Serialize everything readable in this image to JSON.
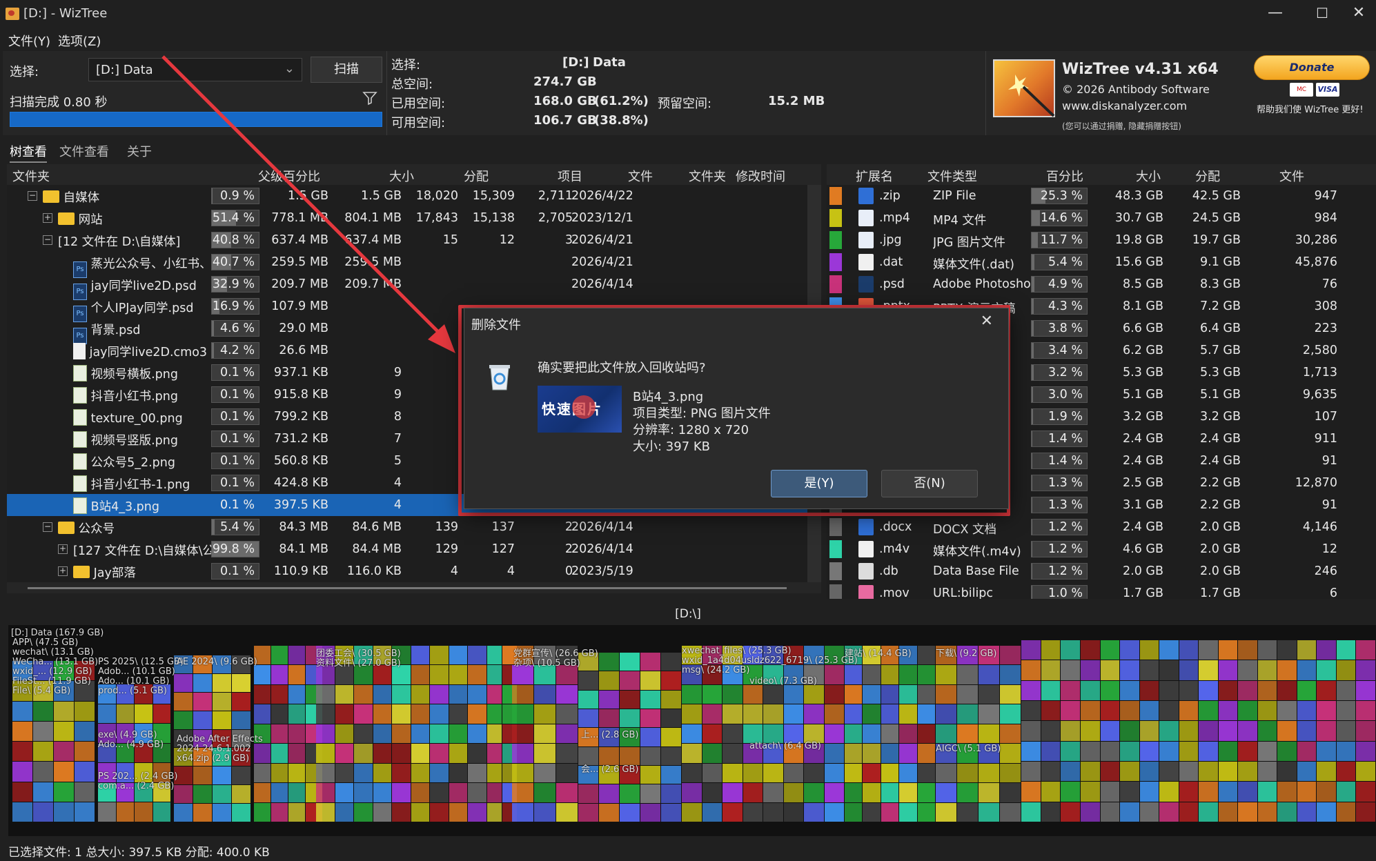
{
  "window": {
    "title": "[D:]  - WizTree",
    "minimize": "—",
    "maximize": "☐",
    "close": "✕"
  },
  "menu": [
    "文件(Y)",
    "选项(Z)"
  ],
  "left_panel": {
    "select_label": "选择:",
    "drive_value": "[D:] Data",
    "scan_button": "扫描",
    "scan_status": "扫描完成 0.80 秒"
  },
  "info": {
    "select_label": "选择:",
    "drive": "[D:]",
    "drive_name": "Data",
    "total_label": "总空间:",
    "total_value": "274.7 GB",
    "used_label": "已用空间:",
    "used_value": "168.0 GB",
    "used_pct": "(61.2%)",
    "reserved_label": "预留空间:",
    "reserved_value": "15.2 MB",
    "free_label": "可用空间:",
    "free_value": "106.7 GB",
    "free_pct": "(38.8%)"
  },
  "brand": {
    "name": "WizTree v4.31 x64",
    "copyright": "© 2026 Antibody Software",
    "url": "www.diskanalyzer.com",
    "note": "(您可以通过捐赠, 隐藏捐赠按钮)",
    "donate": "Donate",
    "donate_help": "帮助我们使 WizTree 更好!",
    "mc": "MC",
    "visa": "VISA"
  },
  "tabs": [
    "树查看",
    "文件查看",
    "关于"
  ],
  "tree": {
    "headers": [
      "文件夹",
      "父级百分比",
      "大小",
      "分配",
      "项目",
      "文件",
      "文件夹",
      "修改时间"
    ],
    "rows": [
      {
        "name": "自媒体",
        "pct": "0.9 %",
        "pct_fill": 0.009,
        "size": "1.5 GB",
        "alloc": "1.5 GB",
        "items": "18,020",
        "files": "15,309",
        "folders": "2,711",
        "mtime": "2026/4/22",
        "type": "folder",
        "depth": 1,
        "exp": "−"
      },
      {
        "name": "网站",
        "pct": "51.4 %",
        "pct_fill": 0.514,
        "size": "778.1 MB",
        "alloc": "804.1 MB",
        "items": "17,843",
        "files": "15,138",
        "folders": "2,705",
        "mtime": "2023/12/1",
        "type": "folder",
        "depth": 2,
        "exp": "+"
      },
      {
        "name": "[12 文件在 D:\\自媒体]",
        "pct": "40.8 %",
        "pct_fill": 0.408,
        "size": "637.4 MB",
        "alloc": "637.4 MB",
        "items": "15",
        "files": "12",
        "folders": "3",
        "mtime": "2026/4/21",
        "type": "none",
        "depth": 2,
        "exp": "−"
      },
      {
        "name": "蒸光公众号、小红书、",
        "pct": "40.7 %",
        "pct_fill": 0.407,
        "size": "259.5 MB",
        "alloc": "259.5 MB",
        "items": "",
        "files": "",
        "folders": "",
        "mtime": "2026/4/21",
        "type": "ps",
        "depth": 3
      },
      {
        "name": "jay同学live2D.psd",
        "pct": "32.9 %",
        "pct_fill": 0.329,
        "size": "209.7 MB",
        "alloc": "209.7 MB",
        "items": "",
        "files": "",
        "folders": "",
        "mtime": "2026/4/14",
        "type": "ps",
        "depth": 3
      },
      {
        "name": "个人IPJay同学.psd",
        "pct": "16.9 %",
        "pct_fill": 0.169,
        "size": "107.9 MB",
        "alloc": "",
        "items": "",
        "files": "",
        "folders": "",
        "mtime": "",
        "type": "ps",
        "depth": 3
      },
      {
        "name": "背景.psd",
        "pct": "4.6 %",
        "pct_fill": 0.046,
        "size": "29.0 MB",
        "alloc": "",
        "items": "",
        "files": "",
        "folders": "",
        "mtime": "",
        "type": "ps",
        "depth": 3
      },
      {
        "name": "jay同学live2D.cmo3",
        "pct": "4.2 %",
        "pct_fill": 0.042,
        "size": "26.6 MB",
        "alloc": "",
        "items": "",
        "files": "",
        "folders": "",
        "mtime": "",
        "type": "file",
        "depth": 3
      },
      {
        "name": "视频号横板.png",
        "pct": "0.1 %",
        "pct_fill": 0.001,
        "size": "937.1 KB",
        "alloc": "9",
        "items": "",
        "files": "",
        "folders": "",
        "mtime": "",
        "type": "png",
        "depth": 3
      },
      {
        "name": "抖音小红书.png",
        "pct": "0.1 %",
        "pct_fill": 0.001,
        "size": "915.8 KB",
        "alloc": "9",
        "items": "",
        "files": "",
        "folders": "",
        "mtime": "",
        "type": "png",
        "depth": 3
      },
      {
        "name": "texture_00.png",
        "pct": "0.1 %",
        "pct_fill": 0.001,
        "size": "799.2 KB",
        "alloc": "8",
        "items": "",
        "files": "",
        "folders": "",
        "mtime": "",
        "type": "png",
        "depth": 3
      },
      {
        "name": "视频号竖版.png",
        "pct": "0.1 %",
        "pct_fill": 0.001,
        "size": "731.2 KB",
        "alloc": "7",
        "items": "",
        "files": "",
        "folders": "",
        "mtime": "",
        "type": "png",
        "depth": 3
      },
      {
        "name": "公众号5_2.png",
        "pct": "0.1 %",
        "pct_fill": 0.001,
        "size": "560.8 KB",
        "alloc": "5",
        "items": "",
        "files": "",
        "folders": "",
        "mtime": "",
        "type": "png",
        "depth": 3
      },
      {
        "name": "抖音小红书-1.png",
        "pct": "0.1 %",
        "pct_fill": 0.001,
        "size": "424.8 KB",
        "alloc": "4",
        "items": "",
        "files": "",
        "folders": "",
        "mtime": "",
        "type": "png",
        "depth": 3
      },
      {
        "name": "B站4_3.png",
        "pct": "0.1 %",
        "pct_fill": 0.001,
        "size": "397.5 KB",
        "alloc": "4",
        "items": "",
        "files": "",
        "folders": "",
        "mtime": "",
        "type": "png",
        "depth": 3,
        "selected": true
      },
      {
        "name": "公众号",
        "pct": "5.4 %",
        "pct_fill": 0.054,
        "size": "84.3 MB",
        "alloc": "84.6 MB",
        "items": "139",
        "files": "137",
        "folders": "2",
        "mtime": "2026/4/14",
        "type": "folder",
        "depth": 2,
        "exp": "−"
      },
      {
        "name": "[127 文件在 D:\\自媒体\\公",
        "pct": "99.8 %",
        "pct_fill": 0.998,
        "size": "84.1 MB",
        "alloc": "84.4 MB",
        "items": "129",
        "files": "127",
        "folders": "2",
        "mtime": "2026/4/14",
        "type": "none",
        "depth": 3,
        "exp": "+"
      },
      {
        "name": "Jay部落",
        "pct": "0.1 %",
        "pct_fill": 0.001,
        "size": "110.9 KB",
        "alloc": "116.0 KB",
        "items": "4",
        "files": "4",
        "folders": "0",
        "mtime": "2023/5/19",
        "type": "folder",
        "depth": 3,
        "exp": "+"
      }
    ]
  },
  "ext": {
    "headers": [
      "扩展名",
      "文件类型",
      "百分比",
      "大小",
      "分配",
      "文件"
    ],
    "rows": [
      {
        "ext": ".zip",
        "type": "ZIP File",
        "pct": "25.3 %",
        "pct_fill": 0.253,
        "size": "48.3 GB",
        "alloc": "42.5 GB",
        "files": "947",
        "color": "#e07b22",
        "icon": "#2f6fd6"
      },
      {
        "ext": ".mp4",
        "type": "MP4 文件",
        "pct": "14.6 %",
        "pct_fill": 0.146,
        "size": "30.7 GB",
        "alloc": "24.5 GB",
        "files": "984",
        "color": "#c7c214",
        "icon": "#e8eef8"
      },
      {
        "ext": ".jpg",
        "type": "JPG 图片文件",
        "pct": "11.7 %",
        "pct_fill": 0.117,
        "size": "19.8 GB",
        "alloc": "19.7 GB",
        "files": "30,286",
        "color": "#27a83a",
        "icon": "#e8eef8"
      },
      {
        "ext": ".dat",
        "type": "媒体文件(.dat)",
        "pct": "5.4 %",
        "pct_fill": 0.054,
        "size": "15.6 GB",
        "alloc": "9.1 GB",
        "files": "45,876",
        "color": "#9b37d8",
        "icon": "#f0f0f0"
      },
      {
        "ext": ".psd",
        "type": "Adobe Photosho",
        "pct": "4.9 %",
        "pct_fill": 0.049,
        "size": "8.5 GB",
        "alloc": "8.3 GB",
        "files": "76",
        "color": "#c8327a",
        "icon": "#1b3c6b"
      },
      {
        "ext": ".pptx",
        "type": "PPTX 演示文稿",
        "pct": "4.3 %",
        "pct_fill": 0.043,
        "size": "8.1 GB",
        "alloc": "7.2 GB",
        "files": "308",
        "color": "#3d8ee8",
        "icon": "#e0553a"
      },
      {
        "ext": "",
        "type": "",
        "pct": "3.8 %",
        "pct_fill": 0.038,
        "size": "6.6 GB",
        "alloc": "6.4 GB",
        "files": "223",
        "color": "#555",
        "icon": ""
      },
      {
        "ext": "",
        "type": "",
        "pct": "3.4 %",
        "pct_fill": 0.034,
        "size": "6.2 GB",
        "alloc": "5.7 GB",
        "files": "2,580",
        "color": "#555",
        "icon": ""
      },
      {
        "ext": "",
        "type": "",
        "pct": "3.2 %",
        "pct_fill": 0.032,
        "size": "5.3 GB",
        "alloc": "5.3 GB",
        "files": "1,713",
        "color": "#555",
        "icon": ""
      },
      {
        "ext": "",
        "type": "",
        "pct": "3.0 %",
        "pct_fill": 0.03,
        "size": "5.1 GB",
        "alloc": "5.1 GB",
        "files": "9,635",
        "color": "#555",
        "icon": ""
      },
      {
        "ext": "",
        "type": "",
        "pct": "1.9 %",
        "pct_fill": 0.019,
        "size": "3.2 GB",
        "alloc": "3.2 GB",
        "files": "107",
        "color": "#555",
        "icon": ""
      },
      {
        "ext": "",
        "type": "",
        "pct": "1.4 %",
        "pct_fill": 0.014,
        "size": "2.4 GB",
        "alloc": "2.4 GB",
        "files": "911",
        "color": "#555",
        "icon": ""
      },
      {
        "ext": "",
        "type": "",
        "pct": "1.4 %",
        "pct_fill": 0.014,
        "size": "2.4 GB",
        "alloc": "2.4 GB",
        "files": "91",
        "color": "#555",
        "icon": ""
      },
      {
        "ext": "",
        "type": "",
        "pct": "1.3 %",
        "pct_fill": 0.013,
        "size": "2.5 GB",
        "alloc": "2.2 GB",
        "files": "12,870",
        "color": "#555",
        "icon": ""
      },
      {
        "ext": "",
        "type": "",
        "pct": "1.3 %",
        "pct_fill": 0.013,
        "size": "3.1 GB",
        "alloc": "2.2 GB",
        "files": "91",
        "color": "#555",
        "icon": ""
      },
      {
        "ext": ".docx",
        "type": "DOCX 文档",
        "pct": "1.2 %",
        "pct_fill": 0.012,
        "size": "2.4 GB",
        "alloc": "2.0 GB",
        "files": "4,146",
        "color": "#666",
        "icon": "#2f6fd6"
      },
      {
        "ext": ".m4v",
        "type": "媒体文件(.m4v)",
        "pct": "1.2 %",
        "pct_fill": 0.012,
        "size": "4.6 GB",
        "alloc": "2.0 GB",
        "files": "12",
        "color": "#2ed3a8",
        "icon": "#f0f0f0"
      },
      {
        "ext": ".db",
        "type": "Data Base File",
        "pct": "1.2 %",
        "pct_fill": 0.012,
        "size": "2.0 GB",
        "alloc": "2.0 GB",
        "files": "246",
        "color": "#777",
        "icon": "#dcdcdc"
      },
      {
        "ext": ".mov",
        "type": "URL:bilipc",
        "pct": "1.0 %",
        "pct_fill": 0.01,
        "size": "1.7 GB",
        "alloc": "1.7 GB",
        "files": "6",
        "color": "#666",
        "icon": "#e86aa0"
      }
    ]
  },
  "treemap": {
    "root_label": "[D:\\]",
    "title": "[D:] Data  (167.9 GB)",
    "labels": [
      "APP\\ (47.5 GB)",
      "wechat\\ (13.1 GB)",
      "WeCha... (13.1 GB)",
      "wxid_... (12.9 GB)",
      "FileSt... (11.9 GB)",
      "File\\ (5.4 GB)",
      "PS 2025\\ (12.5 GB)",
      "Adob... (10.1 GB)",
      "Ado... (10.1 GB)",
      "prod... (5.1 GB)",
      "exe\\ (4.9 GB)",
      "Ado... (4.9 GB)",
      "PS 202... (2.4 GB)",
      "com.a... (2.4 GB)",
      "AE 2024\\ (9.6 GB)",
      "Adobe After Effects",
      "2024 24.6.1.002",
      "x64.zip (2.9 GB)",
      "团委工会\\ (30.5 GB)",
      "资料文件\\ (27.0 GB)",
      "党群宣传\\ (26.6 GB)",
      "杂项\\ (10.5 GB)",
      "上... (2.8 GB)",
      "会... (2.6 GB)",
      "xwechat_files\\ (25.3 GB)",
      "wxid_1a4d04usldz622_6719\\ (25.3 GB)",
      "msg\\ (24.2 GB)",
      "video\\ (7.3 GB)",
      "attach\\ (6.4 GB)",
      "建站\\ (14.4 GB)",
      "下载\\ (9.2 GB)",
      "AIGC\\ (5.1 GB)"
    ]
  },
  "status": "已选择文件: 1  总大小: 397.5 KB  分配: 400.0 KB",
  "dialog": {
    "title": "删除文件",
    "question": "确实要把此文件放入回收站吗?",
    "file_name": "B站4_3.png",
    "file_type": "项目类型: PNG 图片文件",
    "resolution": "分辨率: 1280 x 720",
    "size": "大小: 397 KB",
    "thumb_text": "快速图片",
    "yes": "是(Y)",
    "no": "否(N)",
    "close": "✕"
  }
}
